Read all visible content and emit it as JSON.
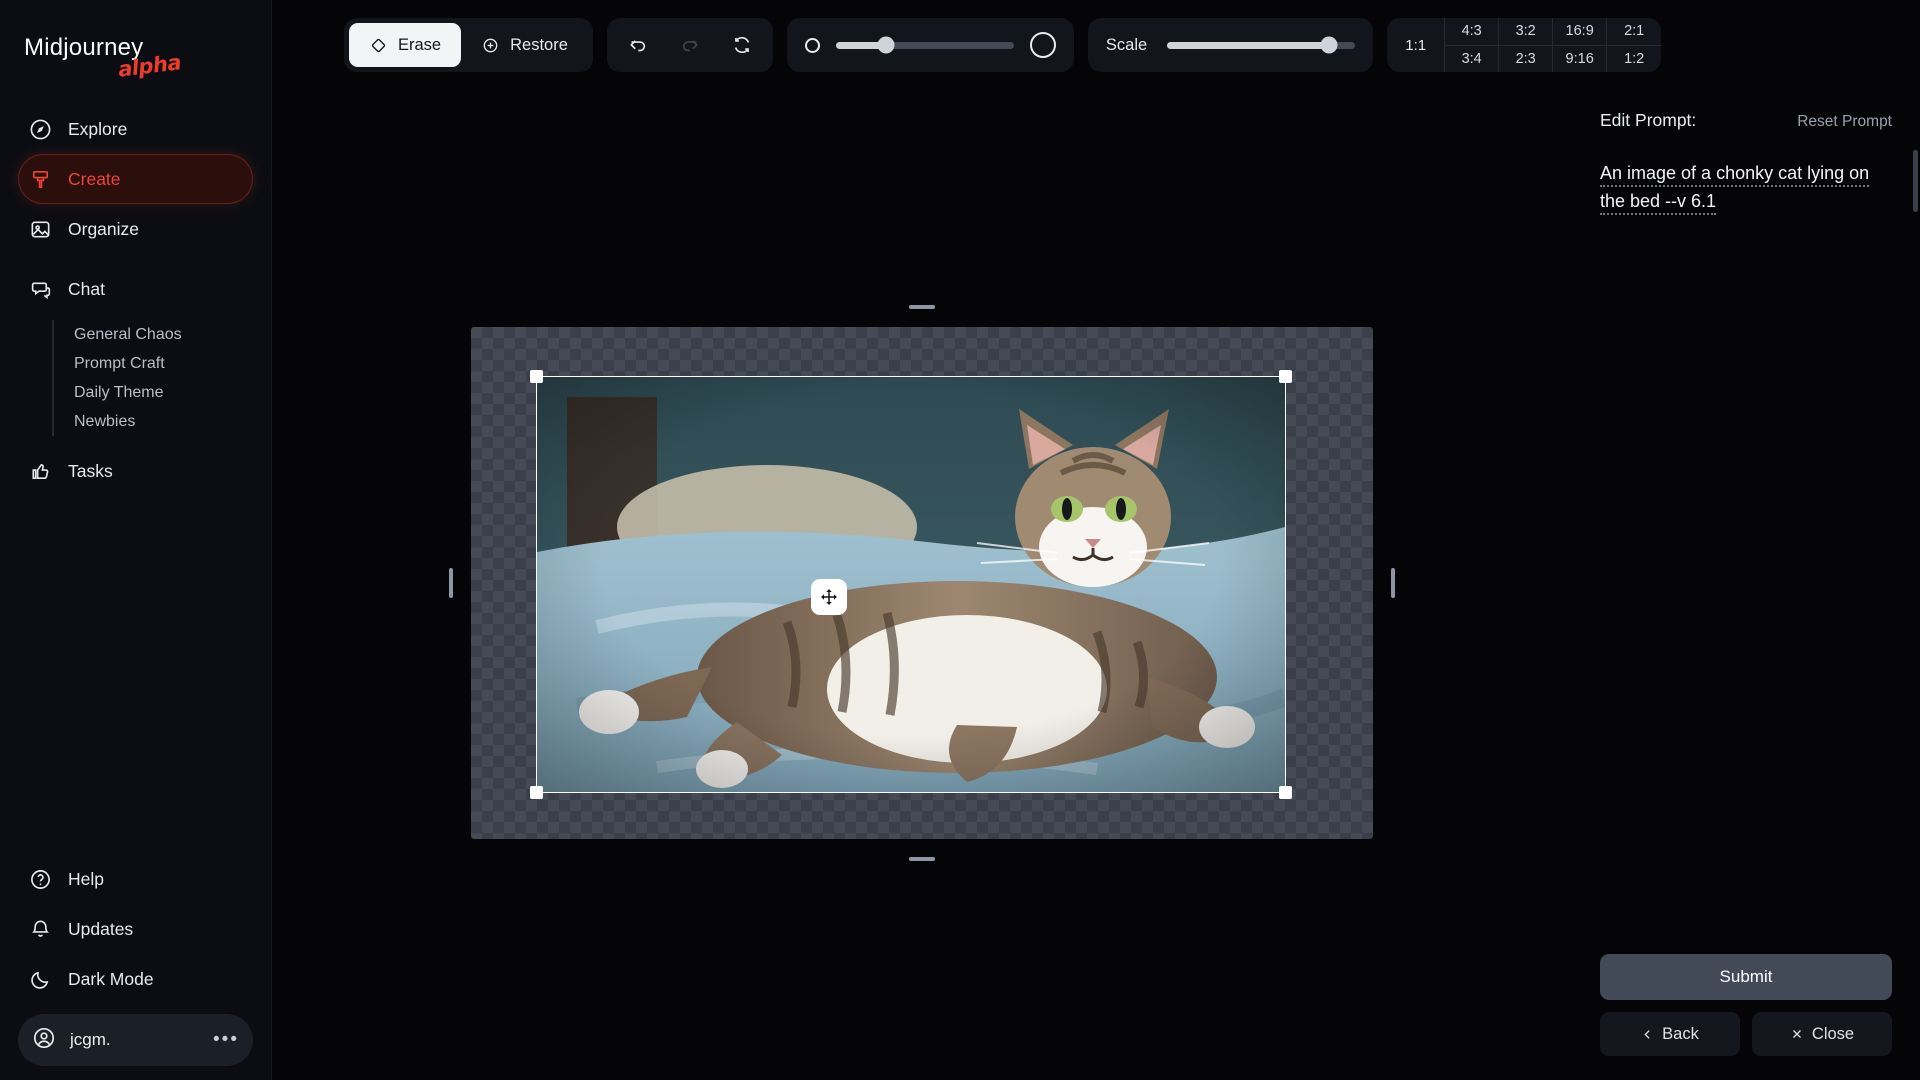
{
  "sidebar": {
    "brand": {
      "name": "Midjourney",
      "tag": "alpha"
    },
    "items": [
      {
        "label": "Explore",
        "icon": "compass-icon"
      },
      {
        "label": "Create",
        "icon": "brush-icon",
        "active": true
      },
      {
        "label": "Organize",
        "icon": "image-icon"
      },
      {
        "label": "Chat",
        "icon": "chat-bubbles-icon"
      }
    ],
    "chat_channels": [
      "General Chaos",
      "Prompt Craft",
      "Daily Theme",
      "Newbies"
    ],
    "tasks": {
      "label": "Tasks",
      "icon": "thumbs-up-icon"
    },
    "bottom_items": [
      {
        "label": "Help",
        "icon": "question-circle-icon"
      },
      {
        "label": "Updates",
        "icon": "bell-icon"
      },
      {
        "label": "Dark Mode",
        "icon": "moon-icon"
      }
    ],
    "user": {
      "name": "jcgm.",
      "icon": "avatar-icon",
      "menu": "•••"
    }
  },
  "toolbar": {
    "erase_label": "Erase",
    "restore_label": "Restore",
    "erase_active": true,
    "undo_label": "Undo",
    "redo_label": "Redo",
    "reset_label": "Reset",
    "redo_disabled": true,
    "brush_size_percent": 28,
    "scale_label": "Scale",
    "scale_percent": 86,
    "ratios_primary": "1:1",
    "ratios_top": [
      "4:3",
      "3:2",
      "16:9",
      "2:1"
    ],
    "ratios_bottom": [
      "3:4",
      "2:3",
      "9:16",
      "1:2"
    ]
  },
  "panel": {
    "title": "Edit Prompt:",
    "reset": "Reset Prompt",
    "prompt_text": "An image of a chonky cat lying on the bed --v 6.1",
    "submit": "Submit",
    "back": "Back",
    "close": "Close"
  },
  "canvas": {
    "alt": "Tabby and white chonky cat lying on its back on a blue bed",
    "move_handle": "move-handle"
  },
  "colors": {
    "accent": "#ef4436",
    "sidebar_bg": "#0b0d12",
    "panel_bg": "#12151c",
    "canvas_checker": "#454a56"
  }
}
